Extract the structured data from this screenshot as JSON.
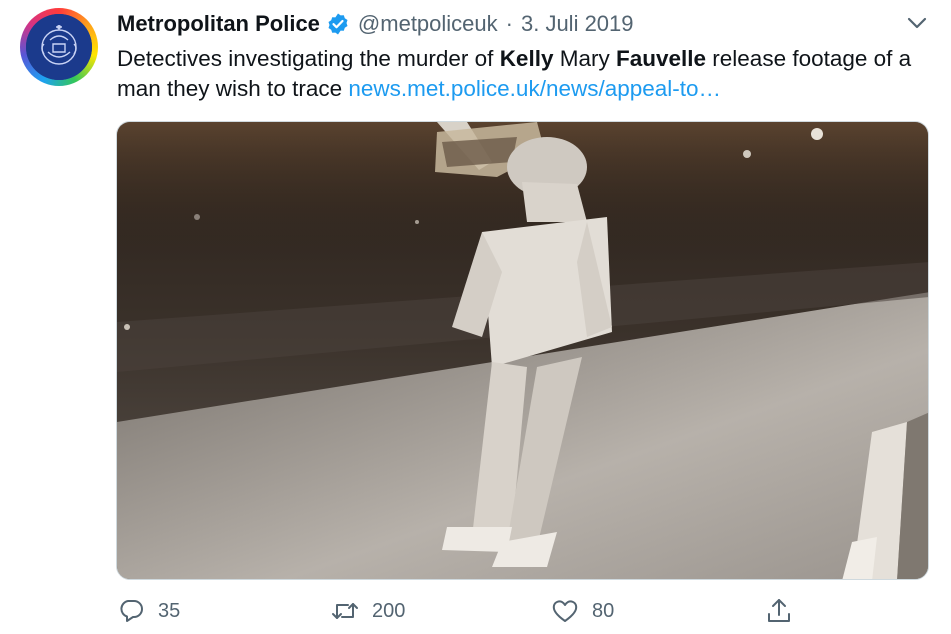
{
  "tweet": {
    "display_name": "Metropolitan Police",
    "handle": "@metpoliceuk",
    "separator": "·",
    "date": "3. Juli 2019",
    "text": {
      "part1": "Detectives investigating the murder of ",
      "bold1": "Kelly",
      "part2": " Mary ",
      "bold2": "Fauvelle",
      "part3": " release footage of a man they wish to trace ",
      "link": "news.met.police.uk/news/appeal-to…"
    },
    "media": {
      "icon": "cctv-image"
    }
  },
  "actions": {
    "reply_count": "35",
    "retweet_count": "200",
    "like_count": "80"
  },
  "icons": {
    "verified": "verified-badge-icon",
    "more": "chevron-down-icon",
    "reply": "reply-icon",
    "retweet": "retweet-icon",
    "like": "heart-icon",
    "share": "share-icon"
  },
  "colors": {
    "link": "#1d9bf0",
    "verified": "#1d9bf0",
    "muted": "#536471",
    "avatar_bg": "#1b3a8c"
  }
}
